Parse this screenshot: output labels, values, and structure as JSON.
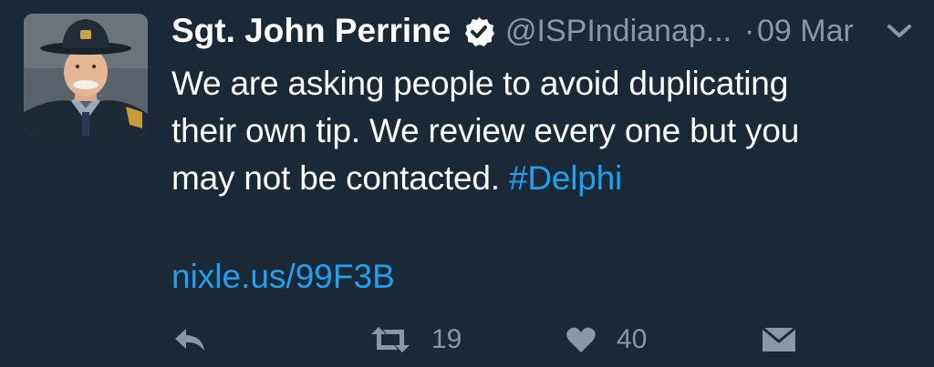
{
  "tweet": {
    "author_name": "Sgt. John Perrine",
    "handle": "@ISPIndianap...",
    "separator": "·",
    "time": "09 Mar",
    "text_lines": [
      "We are asking people to avoid duplicating",
      "their own tip. We review every one but you",
      "may not be contacted."
    ],
    "hashtag": "#Delphi",
    "link": "nixle.us/99F3B"
  },
  "actions": {
    "retweet_count": "19",
    "like_count": "40"
  },
  "icons": {
    "verified": "verified-badge-icon",
    "menu": "chevron-down-icon",
    "reply": "reply-icon",
    "retweet": "retweet-icon",
    "like": "heart-icon",
    "message": "envelope-icon"
  },
  "colors": {
    "background": "#1b2836",
    "text": "#ffffff",
    "secondary": "#8899a6",
    "link": "#1da1f2"
  }
}
